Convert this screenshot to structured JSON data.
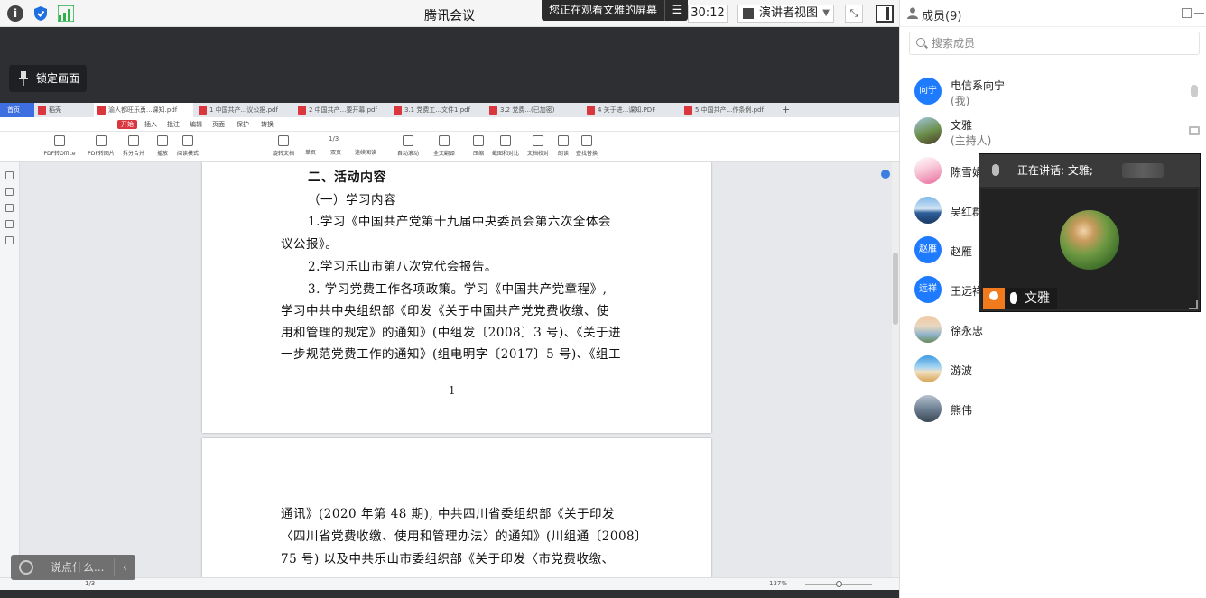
{
  "topbar": {
    "title": "腾讯会议",
    "sharing_banner": "您正在观看文雅的屏幕",
    "timer": "30:12",
    "view_mode": "演讲者视图"
  },
  "main": {
    "lock_label": "锁定画面",
    "chat_placeholder": "说点什么..."
  },
  "wps": {
    "tabs": [
      {
        "label": "首页"
      },
      {
        "label": "稻壳"
      },
      {
        "label": "渝人都旺乐勇...课知.pdf"
      },
      {
        "label": "1 中国共产...议公报.pdf"
      },
      {
        "label": "2 中国共产...要开幕.pdf"
      },
      {
        "label": "3.1 党费工...文件1.pdf"
      },
      {
        "label": "3.2 党费...(已加密)"
      },
      {
        "label": "4 关于进...课知.PDF"
      },
      {
        "label": "5 中国共产...作条例.pdf"
      }
    ],
    "menu": [
      "开始",
      "插入",
      "批注",
      "编辑",
      "页面",
      "保护",
      "转换"
    ],
    "ribbon": [
      "PDF转Office",
      "PDF转图片",
      "拆分合并",
      "播放",
      "阅读模式",
      "旋转文档",
      "单页",
      "双页",
      "连续阅读",
      "自动滚动",
      "全文翻译",
      "压缩",
      "截图和对比",
      "文档校对",
      "朗读",
      "查找替换"
    ],
    "page_indicator": "1/3",
    "zoom": "137%",
    "document": {
      "page1_lines": [
        "二、活动内容",
        "（一）学习内容",
        "1.学习《中国共产党第十九届中央委员会第六次全体会",
        "议公报》。",
        "2.学习乐山市第八次党代会报告。",
        "3. 学习党费工作各项政策。学习《中国共产党章程》,",
        "学习中共中央组织部《印发《关于中国共产党党费收缴、使",
        "用和管理的规定》的通知》(中组发〔2008〕3 号)、《关于进",
        "一步规范党费工作的通知》(组电明字〔2017〕5 号)、《组工"
      ],
      "page1_number": "- 1 -",
      "page2_lines": [
        "通讯》(2020 年第 48 期), 中共四川省委组织部《关于印发",
        "〈四川省党费收缴、使用和管理办法〉的通知》(川组通〔2008〕",
        "75 号) 以及中共乐山市委组织部《关于印发〈市党费收缴、"
      ]
    }
  },
  "members_panel": {
    "title": "成员(9)",
    "search_placeholder": "搜索成员",
    "members": [
      {
        "name": "电信系向宁",
        "role": "(我)",
        "avatar_text": "向宁"
      },
      {
        "name": "文雅",
        "role": "(主持人)"
      },
      {
        "name": "陈雪娟"
      },
      {
        "name": "吴红群"
      },
      {
        "name": "赵雁",
        "avatar_text": "赵雁"
      },
      {
        "name": "王远祥",
        "avatar_text": "远祥"
      },
      {
        "name": "徐永忠"
      },
      {
        "name": "游波"
      },
      {
        "name": "熊伟"
      }
    ]
  },
  "video": {
    "speaking_label": "正在讲话: 文雅;",
    "name": "文雅"
  },
  "colors": {
    "accent": "#1e7bff",
    "dark_bg": "#2d2f33",
    "wps_red": "#d9363e",
    "video_tag": "#f07a1c"
  }
}
